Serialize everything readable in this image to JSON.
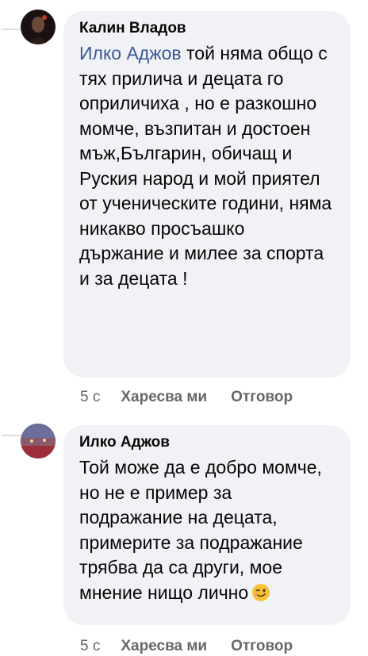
{
  "comments": [
    {
      "author": "Калин Владов",
      "mention": "Илко Аджов",
      "text": " той няма общо с тях прилича и децата го оприличиха , но е разкошно момче, възпитан и достоен мъж,Българин, обичащ и Руския народ и мой приятел от ученическите години, няма никакво просъашко държание и милее за спорта и за децата !",
      "time": "5 с",
      "like_label": "Харесва ми",
      "reply_label": "Отговор"
    },
    {
      "author": "Илко Аджов",
      "text": "Той може да е добро момче, но не е пример за подражание на децата, примерите за подражание трябва да са други, мое мнение нищо лично",
      "emoji": "winking-face",
      "time": "5 с",
      "like_label": "Харесва ми",
      "reply_label": "Отговор"
    }
  ],
  "colors": {
    "bubble": "#f0f2f5",
    "mention": "#385898",
    "meta": "#65676b",
    "text": "#050505"
  }
}
